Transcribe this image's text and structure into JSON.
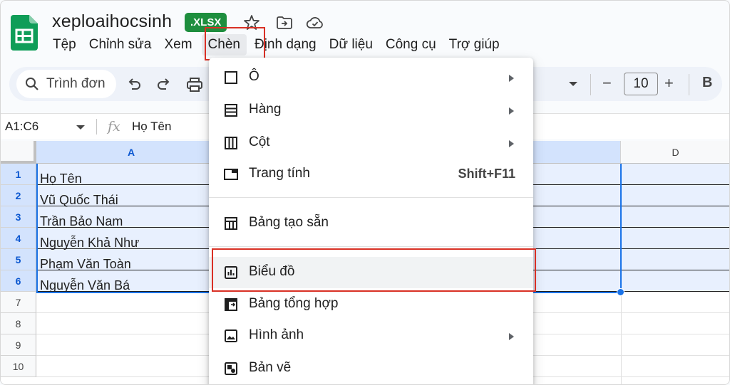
{
  "doc": {
    "title": "xeploaihocsinh",
    "badge": ".XLSX"
  },
  "menubar": {
    "items": [
      "Tệp",
      "Chỉnh sửa",
      "Xem",
      "Chèn",
      "Định dạng",
      "Dữ liệu",
      "Công cụ",
      "Trợ giúp"
    ],
    "active": "Chèn"
  },
  "toolbar": {
    "search_label": "Trình đơn",
    "font_size": "10",
    "minus": "−",
    "plus": "+",
    "bold": "B"
  },
  "formula_bar": {
    "range": "A1:C6",
    "fx": "fx",
    "value": "Họ Tên"
  },
  "grid": {
    "columns": [
      "A",
      "D"
    ],
    "rows": [
      "1",
      "2",
      "3",
      "4",
      "5",
      "6",
      "7",
      "8",
      "9",
      "10"
    ],
    "col_a_values": [
      "Họ Tên",
      "Vũ Quốc Thái",
      "Trần Bảo Nam",
      "Nguyễn Khả Như",
      "Phạm Văn Toàn",
      "Nguyễn Văn Bá"
    ]
  },
  "insert_menu": {
    "items": [
      {
        "label": "Ô",
        "submenu": true,
        "icon": "cell-icon"
      },
      {
        "label": "Hàng",
        "submenu": true,
        "icon": "rows-icon"
      },
      {
        "label": "Cột",
        "submenu": true,
        "icon": "columns-icon"
      },
      {
        "label": "Trang tính",
        "shortcut": "Shift+F11",
        "icon": "sheet-icon"
      },
      {
        "label": "Bảng tạo sẵn",
        "icon": "table-icon"
      },
      {
        "label": "Biểu đồ",
        "icon": "chart-icon",
        "highlighted": true
      },
      {
        "label": "Bảng tổng hợp",
        "icon": "pivot-icon"
      },
      {
        "label": "Hình ảnh",
        "submenu": true,
        "icon": "image-icon"
      },
      {
        "label": "Bản vẽ",
        "icon": "drawing-icon"
      }
    ]
  },
  "colors": {
    "accent": "#1a73e8",
    "highlight_border": "#d93025",
    "badge_green": "#1e8e3e",
    "selection_fill": "#e8f0fe"
  }
}
